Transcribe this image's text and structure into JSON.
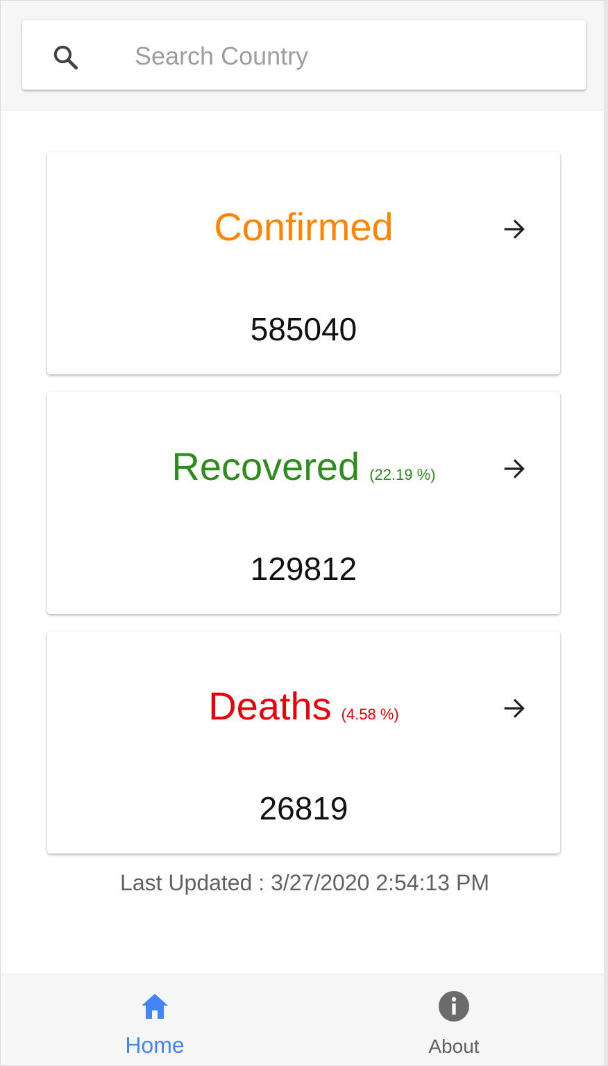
{
  "search": {
    "placeholder": "Search Country",
    "icon": "search-icon"
  },
  "cards": [
    {
      "label": "Confirmed",
      "percent": "",
      "value": "585040",
      "color": "#ff8400",
      "icon": "arrow-right-icon"
    },
    {
      "label": "Recovered",
      "percent": "(22.19 %)",
      "value": "129812",
      "color": "#2e8b1e",
      "icon": "arrow-right-icon"
    },
    {
      "label": "Deaths",
      "percent": "(4.58 %)",
      "value": "26819",
      "color": "#e8000b",
      "icon": "arrow-right-icon"
    }
  ],
  "last_updated": "Last Updated : 3/27/2020 2:54:13 PM",
  "nav": {
    "home_label": "Home",
    "about_label": "About",
    "active": "Home",
    "active_color": "#4285f4"
  }
}
